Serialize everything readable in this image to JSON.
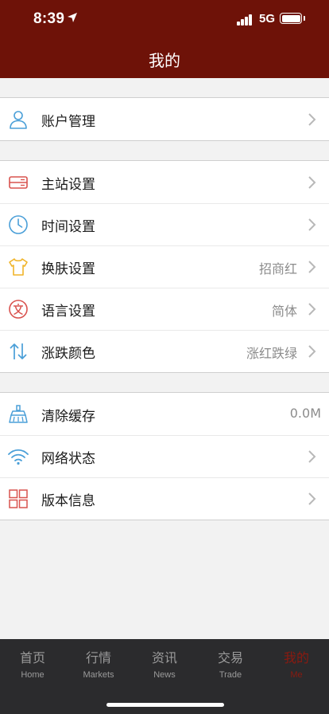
{
  "status_bar": {
    "time": "8:39",
    "network": "5G"
  },
  "header": {
    "title": "我的"
  },
  "groups": [
    {
      "items": [
        {
          "label": "账户管理",
          "icon": "person-icon"
        }
      ]
    },
    {
      "items": [
        {
          "label": "主站设置",
          "icon": "server-icon"
        },
        {
          "label": "时间设置",
          "icon": "clock-icon"
        },
        {
          "label": "换肤设置",
          "value": "招商红",
          "icon": "shirt-icon"
        },
        {
          "label": "语言设置",
          "value": "简体",
          "icon": "language-icon"
        },
        {
          "label": "涨跌颜色",
          "value": "涨红跌绿",
          "icon": "up-down-arrows-icon"
        }
      ]
    },
    {
      "items": [
        {
          "label": "清除缓存",
          "value": "0.0M",
          "icon": "broom-icon"
        },
        {
          "label": "网络状态",
          "icon": "wifi-icon"
        },
        {
          "label": "版本信息",
          "icon": "grid-icon"
        }
      ]
    }
  ],
  "tabs": [
    {
      "cn": "首页",
      "en": "Home"
    },
    {
      "cn": "行情",
      "en": "Markets"
    },
    {
      "cn": "资讯",
      "en": "News"
    },
    {
      "cn": "交易",
      "en": "Trade"
    },
    {
      "cn": "我的",
      "en": "Me"
    }
  ],
  "active_tab": 4,
  "colors": {
    "brand": "#6e1208",
    "tab_bar": "#2b2b2d",
    "icon_red": "#d9534f",
    "icon_blue": "#4a9fd8",
    "icon_yellow": "#f0b429",
    "active_tab": "#8a1a10"
  }
}
